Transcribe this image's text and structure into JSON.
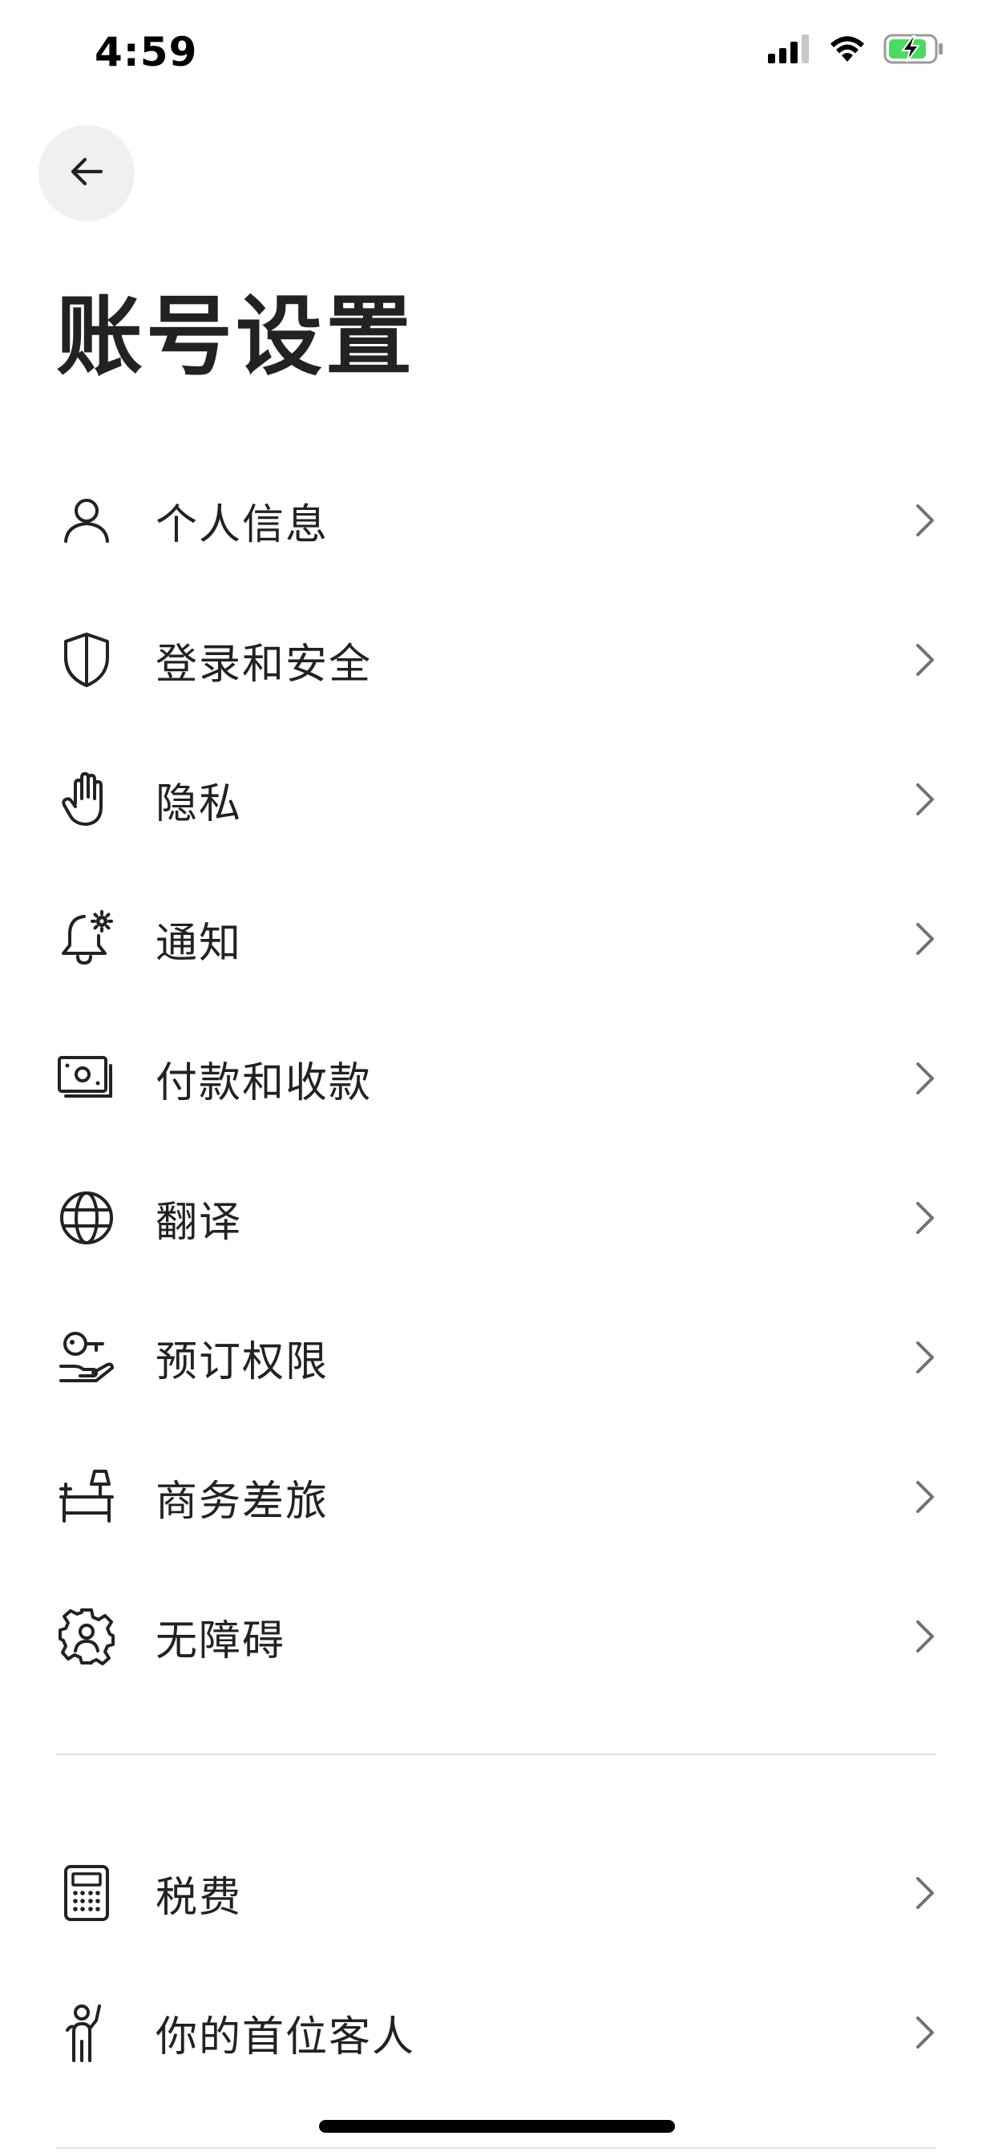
{
  "status_bar": {
    "time": "4:59",
    "battery_color": "#4cd964"
  },
  "header": {
    "back_icon": "arrow-left-icon",
    "title": "账号设置"
  },
  "menu": {
    "items": [
      {
        "label": "个人信息",
        "icon": "person-icon"
      },
      {
        "label": "登录和安全",
        "icon": "shield-icon"
      },
      {
        "label": "隐私",
        "icon": "hand-icon"
      },
      {
        "label": "通知",
        "icon": "bell-gear-icon"
      },
      {
        "label": "付款和收款",
        "icon": "cash-icon"
      },
      {
        "label": "翻译",
        "icon": "globe-icon"
      },
      {
        "label": "预订权限",
        "icon": "key-hand-icon"
      },
      {
        "label": "商务差旅",
        "icon": "desk-icon"
      },
      {
        "label": "无障碍",
        "icon": "gear-person-icon"
      }
    ],
    "secondary_items": [
      {
        "label": "税费",
        "icon": "calculator-icon"
      },
      {
        "label": "你的首位客人",
        "icon": "waving-person-icon"
      }
    ]
  },
  "colors": {
    "text": "#222222",
    "chevron": "#717171",
    "divider": "#e4e4e4",
    "back_button_bg": "#f0f0f0"
  }
}
